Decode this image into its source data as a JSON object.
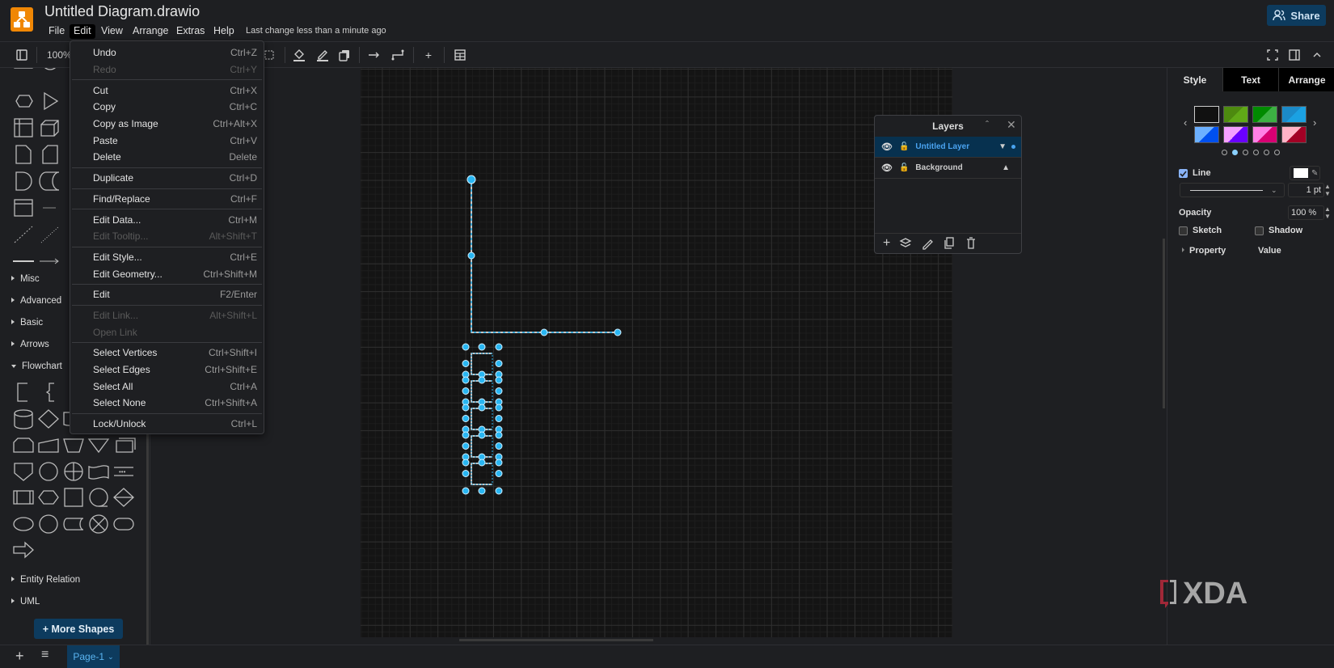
{
  "header": {
    "title": "Untitled Diagram.drawio",
    "menus": [
      "File",
      "Edit",
      "View",
      "Arrange",
      "Extras",
      "Help"
    ],
    "active_menu": "Edit",
    "status": "Last change less than a minute ago",
    "share_label": "Share",
    "logo_icon": "drawio-logo"
  },
  "toolbar": {
    "zoom": "100%"
  },
  "edit_menu": {
    "items": [
      {
        "label": "Undo",
        "shortcut": "Ctrl+Z",
        "enabled": true
      },
      {
        "label": "Redo",
        "shortcut": "Ctrl+Y",
        "enabled": false
      },
      {
        "sep": true
      },
      {
        "label": "Cut",
        "shortcut": "Ctrl+X",
        "enabled": true
      },
      {
        "label": "Copy",
        "shortcut": "Ctrl+C",
        "enabled": true
      },
      {
        "label": "Copy as Image",
        "shortcut": "Ctrl+Alt+X",
        "enabled": true
      },
      {
        "label": "Paste",
        "shortcut": "Ctrl+V",
        "enabled": true
      },
      {
        "label": "Delete",
        "shortcut": "Delete",
        "enabled": true
      },
      {
        "sep": true
      },
      {
        "label": "Duplicate",
        "shortcut": "Ctrl+D",
        "enabled": true
      },
      {
        "sep": true
      },
      {
        "label": "Find/Replace",
        "shortcut": "Ctrl+F",
        "enabled": true
      },
      {
        "sep": true
      },
      {
        "label": "Edit Data...",
        "shortcut": "Ctrl+M",
        "enabled": true
      },
      {
        "label": "Edit Tooltip...",
        "shortcut": "Alt+Shift+T",
        "enabled": false
      },
      {
        "sep": true
      },
      {
        "label": "Edit Style...",
        "shortcut": "Ctrl+E",
        "enabled": true
      },
      {
        "label": "Edit Geometry...",
        "shortcut": "Ctrl+Shift+M",
        "enabled": true
      },
      {
        "sep": true
      },
      {
        "label": "Edit",
        "shortcut": "F2/Enter",
        "enabled": true
      },
      {
        "sep": true
      },
      {
        "label": "Edit Link...",
        "shortcut": "Alt+Shift+L",
        "enabled": false
      },
      {
        "label": "Open Link",
        "shortcut": "",
        "enabled": false
      },
      {
        "sep": true
      },
      {
        "label": "Select Vertices",
        "shortcut": "Ctrl+Shift+I",
        "enabled": true
      },
      {
        "label": "Select Edges",
        "shortcut": "Ctrl+Shift+E",
        "enabled": true
      },
      {
        "label": "Select All",
        "shortcut": "Ctrl+A",
        "enabled": true
      },
      {
        "label": "Select None",
        "shortcut": "Ctrl+Shift+A",
        "enabled": true
      },
      {
        "sep": true
      },
      {
        "label": "Lock/Unlock",
        "shortcut": "Ctrl+L",
        "enabled": true
      }
    ]
  },
  "sidebar": {
    "categories": [
      {
        "label": "Misc",
        "open": false
      },
      {
        "label": "Advanced",
        "open": false
      },
      {
        "label": "Basic",
        "open": false
      },
      {
        "label": "Arrows",
        "open": false
      },
      {
        "label": "Flowchart",
        "open": true
      }
    ],
    "bottom_categories": [
      {
        "label": "Entity Relation"
      },
      {
        "label": "UML"
      }
    ],
    "more_shapes": "+ More Shapes"
  },
  "layers": {
    "title": "Layers",
    "rows": [
      {
        "name": "Untitled Layer",
        "selected": true
      },
      {
        "name": "Background",
        "selected": false
      }
    ]
  },
  "format_panel": {
    "tabs": [
      "Style",
      "Text",
      "Arrange"
    ],
    "active_tab": "Style",
    "swatches": [
      [
        "#111111",
        "#111111"
      ],
      [
        "#4d8a0f",
        "#60a917"
      ],
      [
        "#008a00",
        "#3cb043"
      ],
      [
        "#1b8ac8",
        "#1ba1e2"
      ],
      [
        "#6cb0ff",
        "#0050ef"
      ],
      [
        "#f5a0ff",
        "#6a00ff"
      ],
      [
        "#ff80e6",
        "#d80073"
      ],
      [
        "#ffb3c6",
        "#a20025"
      ]
    ],
    "line_label": "Line",
    "line_checked": true,
    "line_color": "#ffffff",
    "line_width": "1 pt",
    "opacity_label": "Opacity",
    "opacity_value": "100 %",
    "sketch_label": "Sketch",
    "shadow_label": "Shadow",
    "property_header": "Property",
    "value_header": "Value",
    "page_dots": 6,
    "active_dot": 1
  },
  "footer": {
    "page_tab": "Page-1"
  },
  "watermark": "XDA",
  "colors": {
    "accent": "#29b6f2",
    "share_bg": "#0d3b5e",
    "selected_layer": "#4aa3f0"
  }
}
